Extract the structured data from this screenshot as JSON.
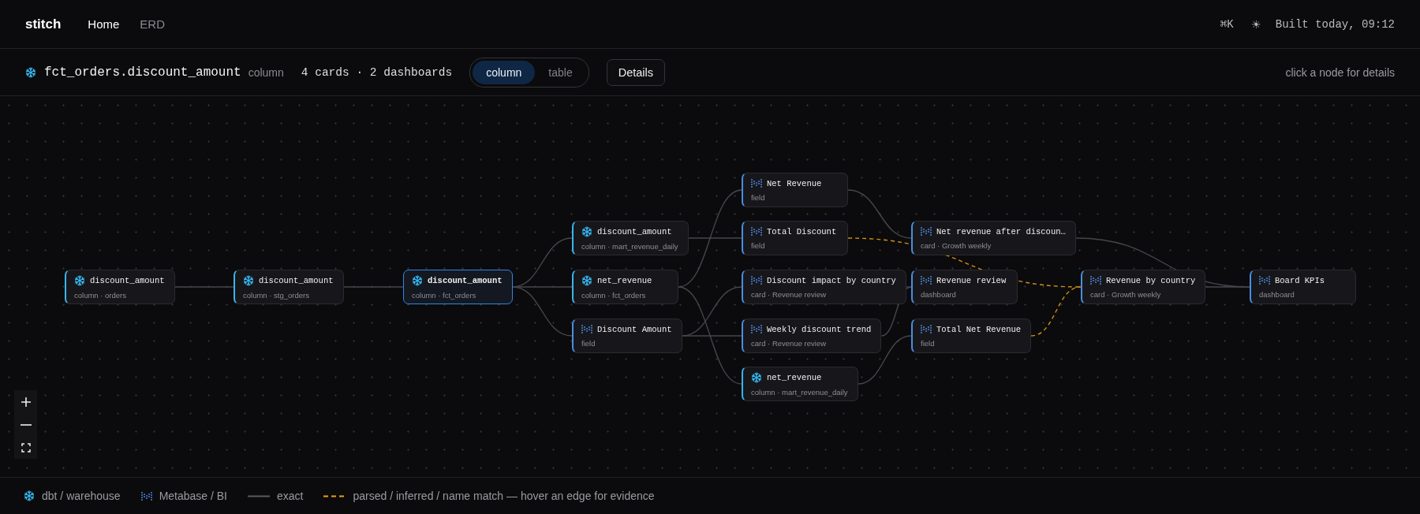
{
  "app": {
    "logo": "stitch",
    "nav": [
      {
        "label": "Home",
        "selected": true
      },
      {
        "label": "ERD",
        "selected": false
      }
    ],
    "shortcut": "⌘K",
    "theme_toggle": "☀",
    "build_status": "Built today, 09:12"
  },
  "toolbar": {
    "title": "fct_orders.discount_amount",
    "title_kind": "column",
    "summary": "4 cards · 2 dashboards",
    "view_modes": [
      {
        "label": "column",
        "selected": true
      },
      {
        "label": "table",
        "selected": false
      }
    ],
    "details_button": "Details",
    "hint": "click a node for details"
  },
  "graph": {
    "nodes": [
      {
        "title": "discount_amount",
        "subtitle": "column · orders",
        "kind": "dbt",
        "selected": false
      },
      {
        "title": "discount_amount",
        "subtitle": "column · stg_orders",
        "kind": "dbt",
        "selected": false
      },
      {
        "title": "discount_amount",
        "subtitle": "column · fct_orders",
        "kind": "dbt",
        "selected": true
      },
      {
        "title": "discount_amount",
        "subtitle": "column · mart_revenue_daily",
        "kind": "dbt",
        "selected": false
      },
      {
        "title": "net_revenue",
        "subtitle": "column · fct_orders",
        "kind": "dbt",
        "selected": false
      },
      {
        "title": "Discount Amount",
        "subtitle": "field",
        "kind": "metabase",
        "selected": false
      },
      {
        "title": "Net Revenue",
        "subtitle": "field",
        "kind": "metabase",
        "selected": false
      },
      {
        "title": "Total Discount",
        "subtitle": "field",
        "kind": "metabase",
        "selected": false
      },
      {
        "title": "Discount impact by country",
        "subtitle": "card · Revenue review",
        "kind": "metabase",
        "selected": false
      },
      {
        "title": "Weekly discount trend",
        "subtitle": "card · Revenue review",
        "kind": "metabase",
        "selected": false
      },
      {
        "title": "net_revenue",
        "subtitle": "column · mart_revenue_daily",
        "kind": "dbt",
        "selected": false
      },
      {
        "title": "Net revenue after discoun…",
        "subtitle": "card · Growth weekly",
        "kind": "metabase",
        "selected": false
      },
      {
        "title": "Revenue review",
        "subtitle": "dashboard",
        "kind": "metabase",
        "selected": false
      },
      {
        "title": "Total Net Revenue",
        "subtitle": "field",
        "kind": "metabase",
        "selected": false
      },
      {
        "title": "Revenue by country",
        "subtitle": "card · Growth weekly",
        "kind": "metabase",
        "selected": false
      },
      {
        "title": "Board KPIs",
        "subtitle": "dashboard",
        "kind": "metabase",
        "selected": false
      }
    ],
    "edges": [
      {
        "kind": "exact"
      },
      {
        "kind": "exact"
      },
      {
        "kind": "exact"
      },
      {
        "kind": "exact"
      },
      {
        "kind": "exact"
      },
      {
        "kind": "exact"
      },
      {
        "kind": "exact"
      },
      {
        "kind": "exact"
      },
      {
        "kind": "exact"
      },
      {
        "kind": "exact"
      },
      {
        "kind": "exact"
      },
      {
        "kind": "inferred"
      },
      {
        "kind": "exact"
      },
      {
        "kind": "exact"
      },
      {
        "kind": "exact"
      },
      {
        "kind": "inferred"
      },
      {
        "kind": "exact"
      },
      {
        "kind": "exact"
      }
    ]
  },
  "legend": [
    {
      "kind": "dbt",
      "label": "dbt / warehouse"
    },
    {
      "kind": "metabase",
      "label": "Metabase / BI"
    },
    {
      "kind": "exact",
      "label": "exact"
    },
    {
      "kind": "inferred",
      "label": "parsed / inferred / name match — hover an edge for evidence"
    }
  ]
}
